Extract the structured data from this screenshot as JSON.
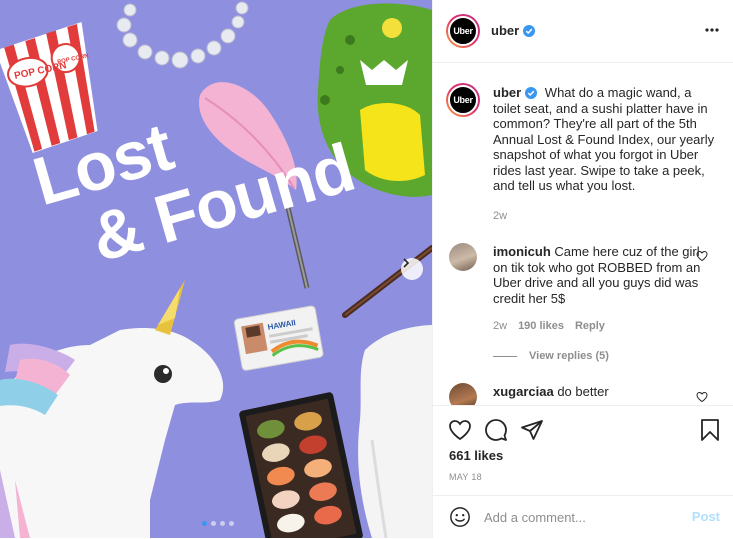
{
  "media": {
    "title_line1": "Lost",
    "title_line2": "& Found",
    "popcorn_text_1": "POP CORN",
    "popcorn_text_2": "POP CORN",
    "id_card_text": "HAWAII",
    "background_color": "#8f8fe0",
    "carousel_dots": 4,
    "active_dot": 1
  },
  "header": {
    "avatar_text": "Uber",
    "username": "uber",
    "verified_icon": "verified-badge-icon",
    "more_icon": "more-options-icon"
  },
  "caption": {
    "avatar_text": "Uber",
    "username": "uber",
    "text": "What do a magic wand, a toilet seat, and a sushi platter have in common? They're all part of the 5th Annual Lost & Found Index, our yearly snapshot of what you forgot in Uber rides last year. Swipe to take a peek, and tell us what you lost.",
    "time": "2w"
  },
  "comments": [
    {
      "username": "imonicuh",
      "text": "Came here cuz of the girl on tik tok who got ROBBED from an Uber drive and all you guys did was credit her 5$",
      "time": "2w",
      "likes": "190 likes",
      "reply_label": "Reply",
      "view_replies": "View replies (5)"
    },
    {
      "username": "xugarciaa",
      "text": "do better"
    }
  ],
  "actions": {
    "like_icon": "heart-icon",
    "comment_icon": "comment-icon",
    "share_icon": "share-icon",
    "save_icon": "bookmark-icon",
    "likes": "661 likes",
    "date": "MAY 18"
  },
  "add_comment": {
    "emoji_icon": "emoji-icon",
    "placeholder": "Add a comment...",
    "post_label": "Post"
  },
  "colors": {
    "link_blue": "#0095f6",
    "post_disabled": "#b2dffc",
    "secondary_text": "#8e8e8e"
  }
}
